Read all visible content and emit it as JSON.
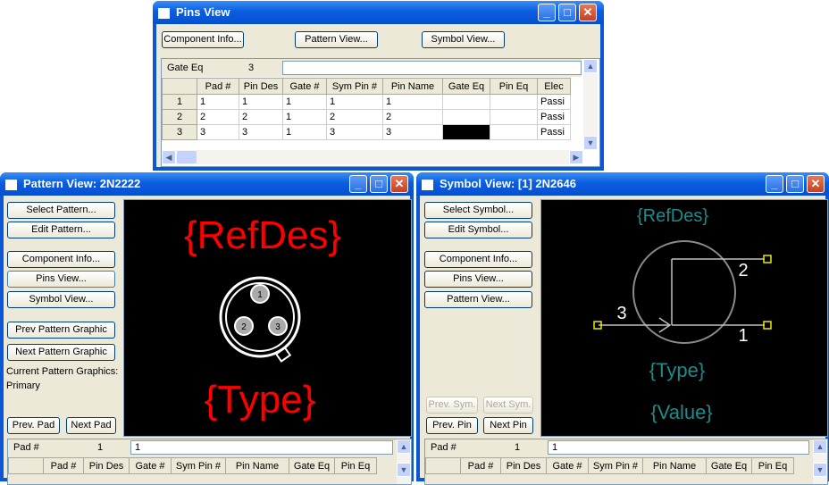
{
  "pins_view": {
    "title": "Pins View",
    "buttons": {
      "component_info": "Component Info...",
      "pattern_view": "Pattern View...",
      "symbol_view": "Symbol View..."
    },
    "gate_eq_label": "Gate Eq",
    "gate_eq_value": "3",
    "columns": [
      "",
      "Pad #",
      "Pin Des",
      "Gate #",
      "Sym Pin #",
      "Pin Name",
      "Gate Eq",
      "Pin Eq",
      "Elec"
    ],
    "rows": [
      [
        "1",
        "1",
        "1",
        "1",
        "1",
        "1",
        "",
        "",
        "Passi"
      ],
      [
        "2",
        "2",
        "2",
        "1",
        "2",
        "2",
        "",
        "",
        "Passi"
      ],
      [
        "3",
        "3",
        "3",
        "1",
        "3",
        "3",
        "",
        "",
        "Passi"
      ]
    ]
  },
  "pattern_view": {
    "title": "Pattern View: 2N2222",
    "buttons": {
      "select_pattern": "Select Pattern...",
      "edit_pattern": "Edit Pattern...",
      "component_info": "Component Info...",
      "pins_view": "Pins View...",
      "symbol_view": "Symbol View...",
      "prev_pattern_graphic": "Prev Pattern Graphic",
      "next_pattern_graphic": "Next Pattern Graphic",
      "prev_pad": "Prev. Pad",
      "next_pad": "Next Pad"
    },
    "current_graphics_label": "Current Pattern Graphics:",
    "current_graphics_value": "Primary",
    "canvas": {
      "refdes": "{RefDes}",
      "type": "{Type}",
      "pad1": "1",
      "pad2": "2",
      "pad3": "3",
      "text_color": "#ff0000"
    },
    "pad_label": "Pad #",
    "pad_number": "1",
    "pad_field_value": "1",
    "columns": [
      "",
      "Pad #",
      "Pin Des",
      "Gate #",
      "Sym Pin #",
      "Pin Name",
      "Gate Eq",
      "Pin Eq"
    ]
  },
  "symbol_view": {
    "title": "Symbol View: [1] 2N2646",
    "buttons": {
      "select_symbol": "Select Symbol...",
      "edit_symbol": "Edit Symbol...",
      "component_info": "Component Info...",
      "pins_view": "Pins View...",
      "pattern_view": "Pattern View...",
      "prev_sym": "Prev. Sym.",
      "next_sym": "Next Sym.",
      "prev_pin": "Prev. Pin",
      "next_pin": "Next Pin"
    },
    "canvas": {
      "refdes": "{RefDes}",
      "type": "{Type}",
      "value": "{Value}",
      "pin1": "1",
      "pin2": "2",
      "pin3": "3",
      "text_color": "#1a8c8c"
    },
    "pad_label": "Pad #",
    "pad_number": "1",
    "pad_field_value": "1",
    "columns": [
      "",
      "Pad #",
      "Pin Des",
      "Gate #",
      "Sym Pin #",
      "Pin Name",
      "Gate Eq",
      "Pin Eq"
    ]
  }
}
